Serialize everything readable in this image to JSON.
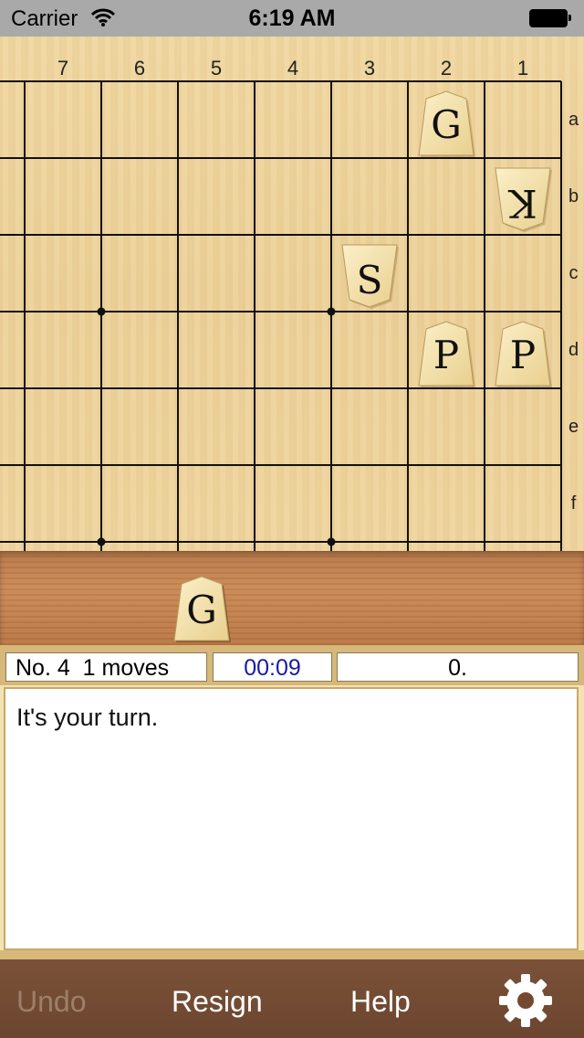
{
  "status_bar": {
    "carrier": "Carrier",
    "time": "6:19 AM"
  },
  "board": {
    "columns": [
      "7",
      "6",
      "5",
      "4",
      "3",
      "2",
      "1"
    ],
    "rows": [
      "a",
      "b",
      "c",
      "d",
      "e",
      "f"
    ],
    "pieces": [
      {
        "label": "G",
        "file": "2",
        "rank": "a",
        "reversed": false
      },
      {
        "label": "K",
        "file": "1",
        "rank": "b",
        "reversed": true
      },
      {
        "label": "S",
        "file": "3",
        "rank": "c",
        "reversed": false
      },
      {
        "label": "P",
        "file": "2",
        "rank": "d",
        "reversed": false
      },
      {
        "label": "P",
        "file": "1",
        "rank": "d",
        "reversed": false
      }
    ]
  },
  "captured": {
    "pieces": [
      {
        "label": "G"
      }
    ]
  },
  "info": {
    "moves": "No. 4  1 moves",
    "timer": "00:09",
    "score": "0."
  },
  "message": "It's your turn.",
  "toolbar": {
    "undo": "Undo",
    "resign": "Resign",
    "help": "Help"
  },
  "colors": {
    "board": "#ecd19a",
    "tray": "#c08050",
    "toolbar": "#74492f",
    "timer_text": "#1a1aa8"
  }
}
